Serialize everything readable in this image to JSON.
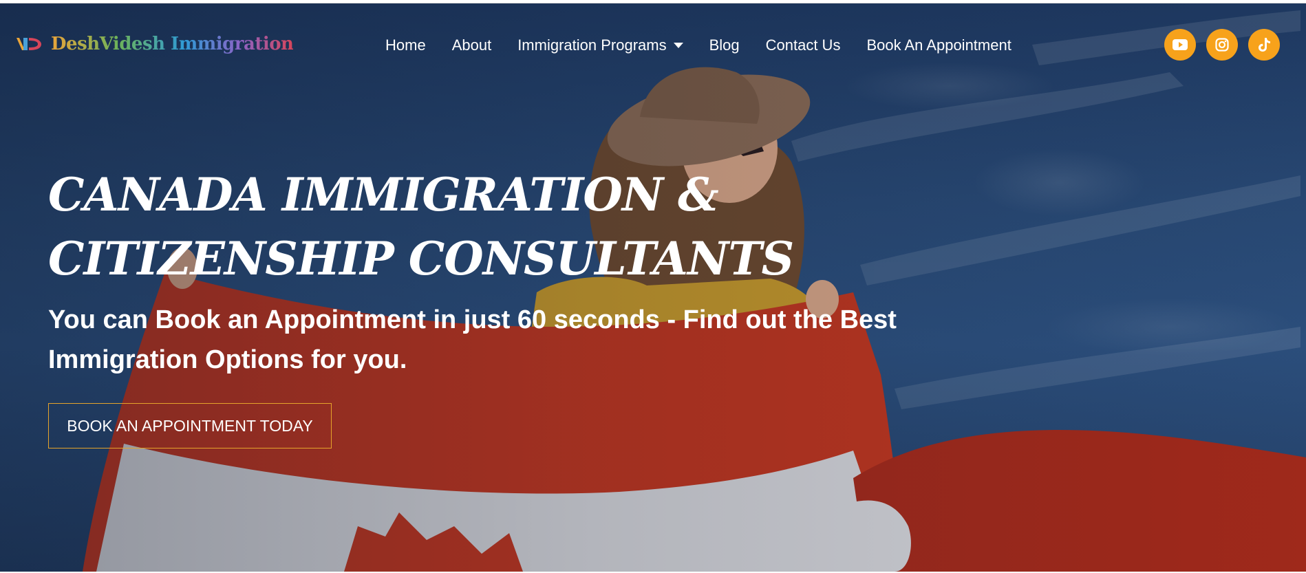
{
  "brand": {
    "name": "DeshVidesh Immigration",
    "logo_icon": "dv-logo-icon"
  },
  "nav": {
    "items": [
      {
        "label": "Home"
      },
      {
        "label": "About"
      },
      {
        "label": "Immigration Programs",
        "has_dropdown": true
      },
      {
        "label": "Blog"
      },
      {
        "label": "Contact Us"
      },
      {
        "label": "Book An Appointment"
      }
    ]
  },
  "social": {
    "accent_color": "#f7a21b",
    "icons": [
      "youtube-icon",
      "instagram-icon",
      "tiktok-icon"
    ]
  },
  "hero": {
    "headline_line1": "CANADA IMMIGRATION &",
    "headline_line2": "CITIZENSHIP CONSULTANTS",
    "subhead_line1": "You can Book an Appointment in just 60 seconds - Find out the Best",
    "subhead_line2": "Immigration Options for you.",
    "cta_label": "BOOK AN APPOINTMENT TODAY",
    "cta_border_color": "#e6a42b"
  }
}
